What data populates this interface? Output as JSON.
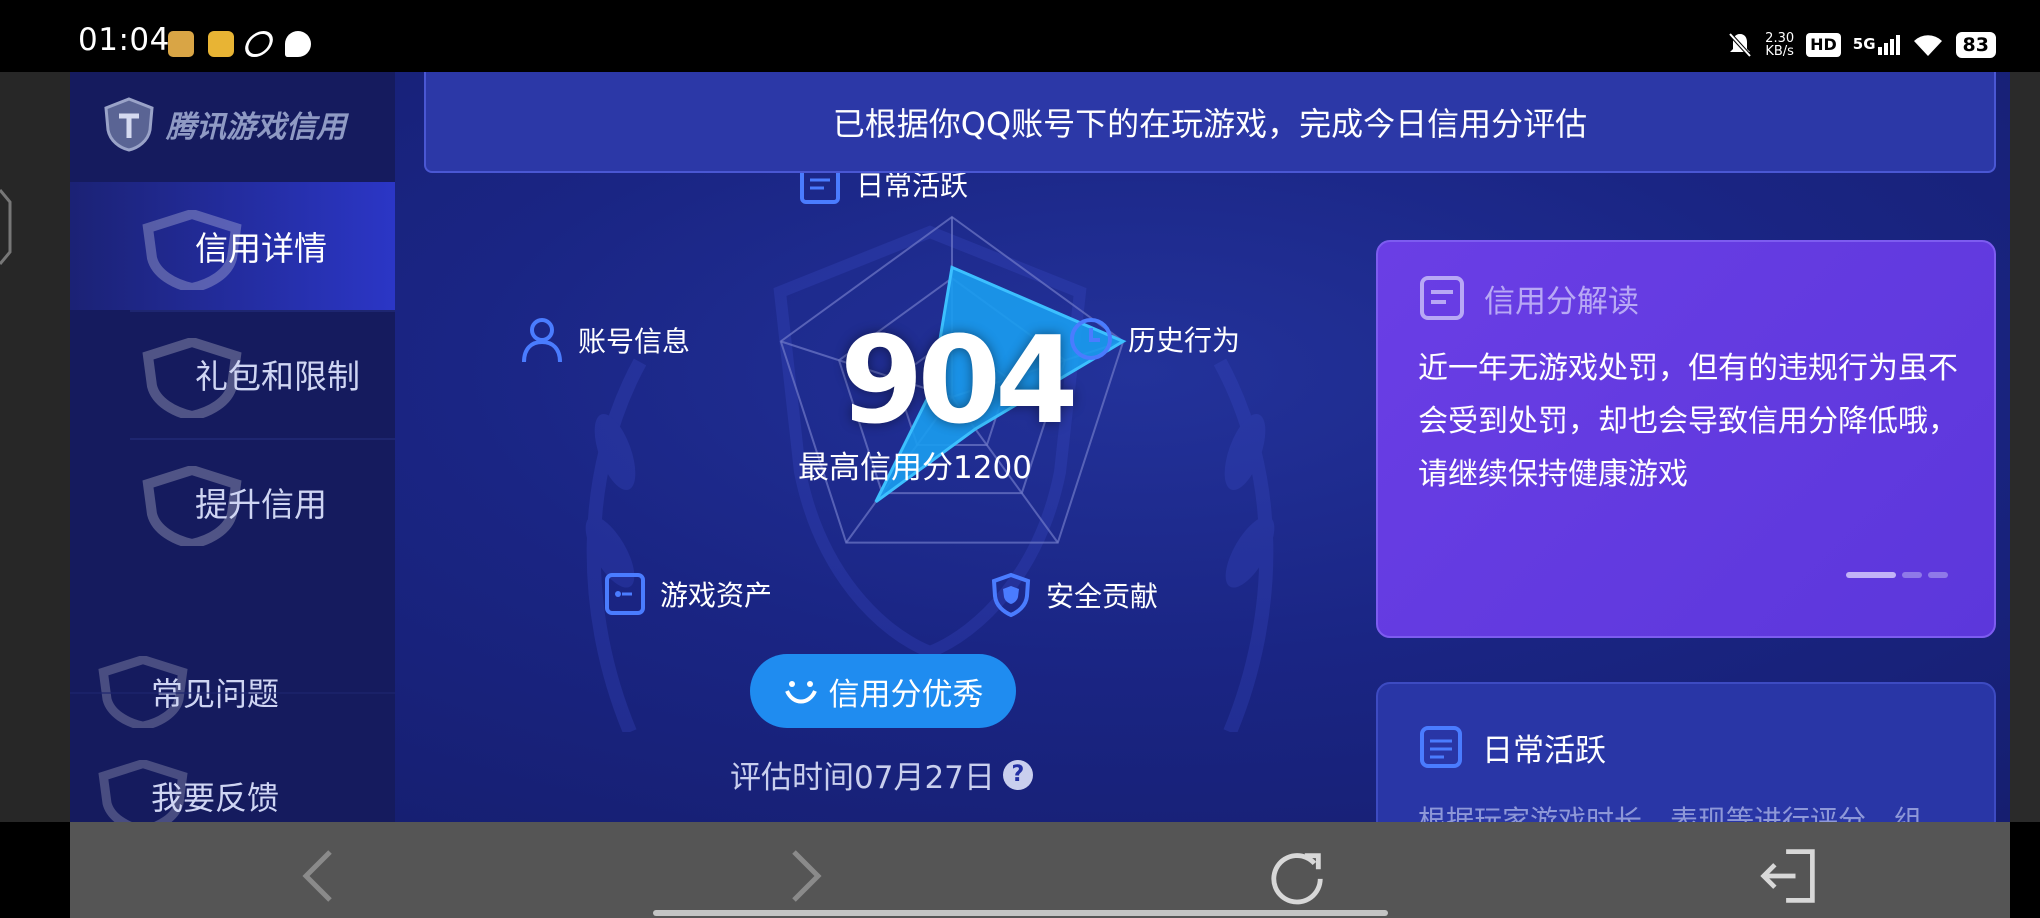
{
  "status_bar": {
    "time": "01:04",
    "net_speed_value": "2.30",
    "net_speed_unit": "KB/s",
    "hd": "HD",
    "network": "5G",
    "battery": "83"
  },
  "sidebar": {
    "logo_text": "腾讯游戏信用",
    "items": [
      {
        "label": "信用详情",
        "active": true
      },
      {
        "label": "礼包和限制",
        "active": false
      },
      {
        "label": "提升信用",
        "active": false
      }
    ],
    "secondary": [
      {
        "label": "常见问题"
      },
      {
        "label": "我要反馈"
      }
    ]
  },
  "banner": {
    "text": "已根据你QQ账号下的在玩游戏，完成今日信用分评估"
  },
  "radar": {
    "score": "904",
    "max_label": "最高信用分1200",
    "axes": [
      {
        "label": "日常活跃",
        "icon": "doc-icon",
        "value": 0.72
      },
      {
        "label": "历史行为",
        "icon": "clock-icon",
        "value": 1.0
      },
      {
        "label": "安全贡献",
        "icon": "shield-icon",
        "value": 0.22
      },
      {
        "label": "游戏资产",
        "icon": "asset-icon",
        "value": 0.72
      },
      {
        "label": "账号信息",
        "icon": "user-icon",
        "value": 0.12
      }
    ],
    "rating_button": "信用分优秀",
    "eval_time": "评估时间07月27日",
    "help": "?"
  },
  "interp_card": {
    "title": "信用分解读",
    "body": "近一年无游戏处罚，但有的违规行为虽不会受到处罚，却也会导致信用分降低哦，请继续保持健康游戏"
  },
  "daily_card": {
    "title": "日常活跃",
    "body": "根据玩家游戏时长、表现等进行评分，组"
  },
  "colors": {
    "accent": "#1f8cf0",
    "card_purple": "#6a3ee5",
    "radar_fill": "#1a9df0"
  }
}
